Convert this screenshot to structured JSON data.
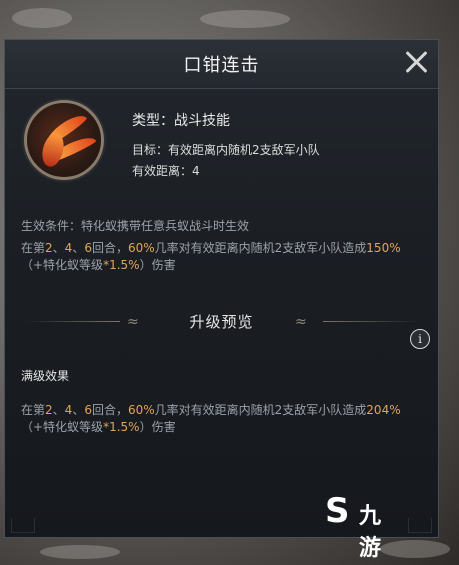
{
  "dialog": {
    "title": "口钳连击",
    "close_icon": "close-icon"
  },
  "skill": {
    "icon": "claw-skill-icon",
    "type_line": "类型：战斗技能",
    "target_line": "目标：有效距离内随机2支敌军小队",
    "range_line": "有效距离：4"
  },
  "current": {
    "condition": "生效条件：特化蚁携带任意兵蚁战斗时生效",
    "desc_prefix": "在第",
    "round_2": "2",
    "sep1": "、",
    "round_4": "4",
    "sep2": "、",
    "round_6": "6",
    "desc_mid1": "回合，",
    "chance": "60%",
    "desc_mid2": "几率对有效距离内随机2支敌军小队造成",
    "damage": "150%",
    "desc_mid3": "（+特化蚁等级",
    "scale": "*1.5%",
    "desc_suffix": "）伤害"
  },
  "upgrade_section": {
    "title": "升级预览",
    "info_icon": "info-icon",
    "info_glyph": "i",
    "max_label": "满级效果"
  },
  "maxed": {
    "desc_prefix": "在第",
    "round_2": "2",
    "sep1": "、",
    "round_4": "4",
    "sep2": "、",
    "round_6": "6",
    "desc_mid1": "回合，",
    "chance": "60%",
    "desc_mid2": "几率对有效距离内随机2支敌军小队造成",
    "damage": "204%",
    "desc_mid3": "（+特化蚁等级",
    "scale": "*1.5%",
    "desc_suffix": "）伤害"
  },
  "watermark": {
    "glyph": "S",
    "text": "九游"
  },
  "colors": {
    "highlight": "#e0a45a",
    "body_text": "#9ba2aa",
    "panel_bg": "#1b1f24"
  }
}
